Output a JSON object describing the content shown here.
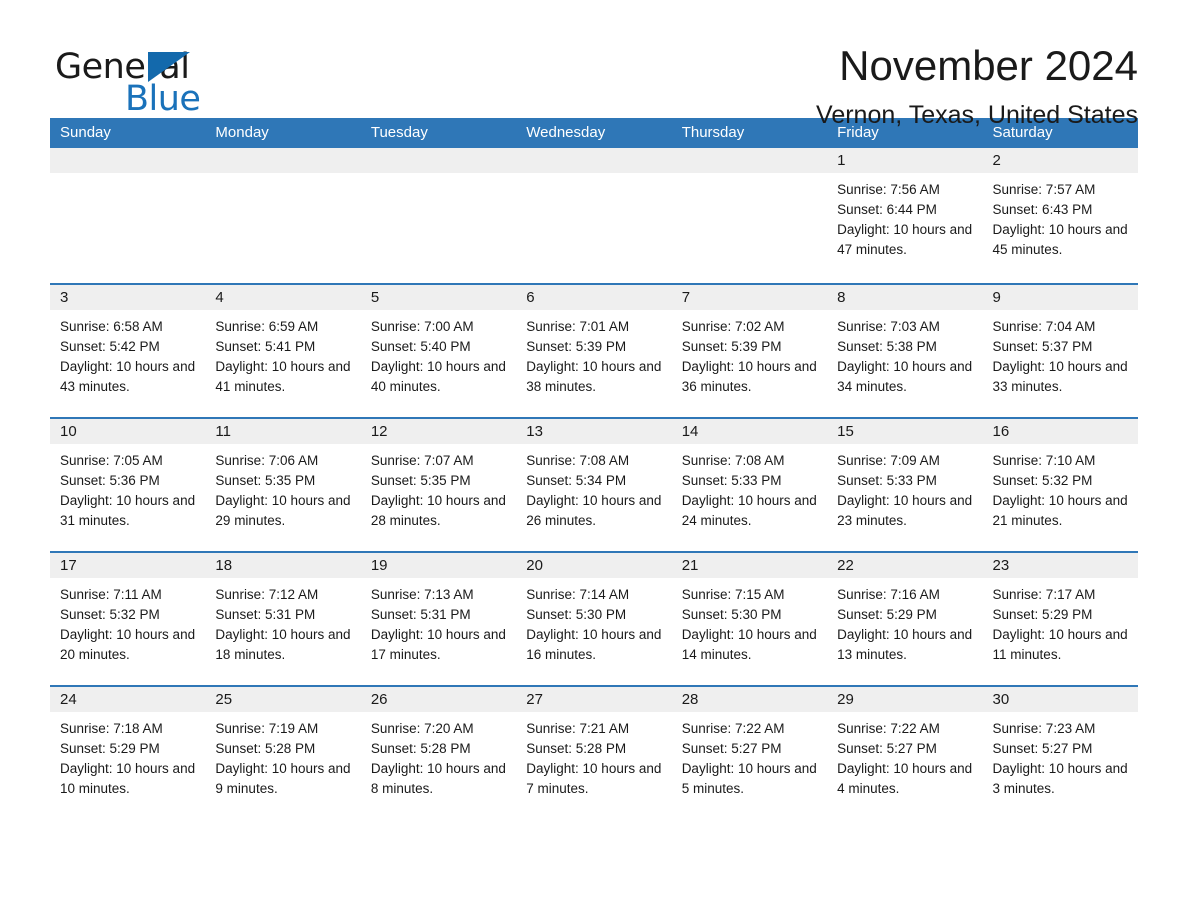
{
  "logo": {
    "word1": "General",
    "word2": "Blue",
    "triangle_color": "#1369ac",
    "blue_color": "#1a72ba"
  },
  "header": {
    "month_title": "November 2024",
    "location": "Vernon, Texas, United States"
  },
  "theme": {
    "header_blue": "#2f77b7",
    "day_band_gray": "#efefef",
    "text": "#1a1a1a"
  },
  "calendar": {
    "weekdays": [
      "Sunday",
      "Monday",
      "Tuesday",
      "Wednesday",
      "Thursday",
      "Friday",
      "Saturday"
    ],
    "weeks": [
      [
        {
          "day": "",
          "sunrise": "",
          "sunset": "",
          "daylight": "",
          "empty": true
        },
        {
          "day": "",
          "sunrise": "",
          "sunset": "",
          "daylight": "",
          "empty": true
        },
        {
          "day": "",
          "sunrise": "",
          "sunset": "",
          "daylight": "",
          "empty": true
        },
        {
          "day": "",
          "sunrise": "",
          "sunset": "",
          "daylight": "",
          "empty": true
        },
        {
          "day": "",
          "sunrise": "",
          "sunset": "",
          "daylight": "",
          "empty": true
        },
        {
          "day": "1",
          "sunrise": "Sunrise: 7:56 AM",
          "sunset": "Sunset: 6:44 PM",
          "daylight": "Daylight: 10 hours and 47 minutes."
        },
        {
          "day": "2",
          "sunrise": "Sunrise: 7:57 AM",
          "sunset": "Sunset: 6:43 PM",
          "daylight": "Daylight: 10 hours and 45 minutes."
        }
      ],
      [
        {
          "day": "3",
          "sunrise": "Sunrise: 6:58 AM",
          "sunset": "Sunset: 5:42 PM",
          "daylight": "Daylight: 10 hours and 43 minutes."
        },
        {
          "day": "4",
          "sunrise": "Sunrise: 6:59 AM",
          "sunset": "Sunset: 5:41 PM",
          "daylight": "Daylight: 10 hours and 41 minutes."
        },
        {
          "day": "5",
          "sunrise": "Sunrise: 7:00 AM",
          "sunset": "Sunset: 5:40 PM",
          "daylight": "Daylight: 10 hours and 40 minutes."
        },
        {
          "day": "6",
          "sunrise": "Sunrise: 7:01 AM",
          "sunset": "Sunset: 5:39 PM",
          "daylight": "Daylight: 10 hours and 38 minutes."
        },
        {
          "day": "7",
          "sunrise": "Sunrise: 7:02 AM",
          "sunset": "Sunset: 5:39 PM",
          "daylight": "Daylight: 10 hours and 36 minutes."
        },
        {
          "day": "8",
          "sunrise": "Sunrise: 7:03 AM",
          "sunset": "Sunset: 5:38 PM",
          "daylight": "Daylight: 10 hours and 34 minutes."
        },
        {
          "day": "9",
          "sunrise": "Sunrise: 7:04 AM",
          "sunset": "Sunset: 5:37 PM",
          "daylight": "Daylight: 10 hours and 33 minutes."
        }
      ],
      [
        {
          "day": "10",
          "sunrise": "Sunrise: 7:05 AM",
          "sunset": "Sunset: 5:36 PM",
          "daylight": "Daylight: 10 hours and 31 minutes."
        },
        {
          "day": "11",
          "sunrise": "Sunrise: 7:06 AM",
          "sunset": "Sunset: 5:35 PM",
          "daylight": "Daylight: 10 hours and 29 minutes."
        },
        {
          "day": "12",
          "sunrise": "Sunrise: 7:07 AM",
          "sunset": "Sunset: 5:35 PM",
          "daylight": "Daylight: 10 hours and 28 minutes."
        },
        {
          "day": "13",
          "sunrise": "Sunrise: 7:08 AM",
          "sunset": "Sunset: 5:34 PM",
          "daylight": "Daylight: 10 hours and 26 minutes."
        },
        {
          "day": "14",
          "sunrise": "Sunrise: 7:08 AM",
          "sunset": "Sunset: 5:33 PM",
          "daylight": "Daylight: 10 hours and 24 minutes."
        },
        {
          "day": "15",
          "sunrise": "Sunrise: 7:09 AM",
          "sunset": "Sunset: 5:33 PM",
          "daylight": "Daylight: 10 hours and 23 minutes."
        },
        {
          "day": "16",
          "sunrise": "Sunrise: 7:10 AM",
          "sunset": "Sunset: 5:32 PM",
          "daylight": "Daylight: 10 hours and 21 minutes."
        }
      ],
      [
        {
          "day": "17",
          "sunrise": "Sunrise: 7:11 AM",
          "sunset": "Sunset: 5:32 PM",
          "daylight": "Daylight: 10 hours and 20 minutes."
        },
        {
          "day": "18",
          "sunrise": "Sunrise: 7:12 AM",
          "sunset": "Sunset: 5:31 PM",
          "daylight": "Daylight: 10 hours and 18 minutes."
        },
        {
          "day": "19",
          "sunrise": "Sunrise: 7:13 AM",
          "sunset": "Sunset: 5:31 PM",
          "daylight": "Daylight: 10 hours and 17 minutes."
        },
        {
          "day": "20",
          "sunrise": "Sunrise: 7:14 AM",
          "sunset": "Sunset: 5:30 PM",
          "daylight": "Daylight: 10 hours and 16 minutes."
        },
        {
          "day": "21",
          "sunrise": "Sunrise: 7:15 AM",
          "sunset": "Sunset: 5:30 PM",
          "daylight": "Daylight: 10 hours and 14 minutes."
        },
        {
          "day": "22",
          "sunrise": "Sunrise: 7:16 AM",
          "sunset": "Sunset: 5:29 PM",
          "daylight": "Daylight: 10 hours and 13 minutes."
        },
        {
          "day": "23",
          "sunrise": "Sunrise: 7:17 AM",
          "sunset": "Sunset: 5:29 PM",
          "daylight": "Daylight: 10 hours and 11 minutes."
        }
      ],
      [
        {
          "day": "24",
          "sunrise": "Sunrise: 7:18 AM",
          "sunset": "Sunset: 5:29 PM",
          "daylight": "Daylight: 10 hours and 10 minutes."
        },
        {
          "day": "25",
          "sunrise": "Sunrise: 7:19 AM",
          "sunset": "Sunset: 5:28 PM",
          "daylight": "Daylight: 10 hours and 9 minutes."
        },
        {
          "day": "26",
          "sunrise": "Sunrise: 7:20 AM",
          "sunset": "Sunset: 5:28 PM",
          "daylight": "Daylight: 10 hours and 8 minutes."
        },
        {
          "day": "27",
          "sunrise": "Sunrise: 7:21 AM",
          "sunset": "Sunset: 5:28 PM",
          "daylight": "Daylight: 10 hours and 7 minutes."
        },
        {
          "day": "28",
          "sunrise": "Sunrise: 7:22 AM",
          "sunset": "Sunset: 5:27 PM",
          "daylight": "Daylight: 10 hours and 5 minutes."
        },
        {
          "day": "29",
          "sunrise": "Sunrise: 7:22 AM",
          "sunset": "Sunset: 5:27 PM",
          "daylight": "Daylight: 10 hours and 4 minutes."
        },
        {
          "day": "30",
          "sunrise": "Sunrise: 7:23 AM",
          "sunset": "Sunset: 5:27 PM",
          "daylight": "Daylight: 10 hours and 3 minutes."
        }
      ]
    ]
  }
}
